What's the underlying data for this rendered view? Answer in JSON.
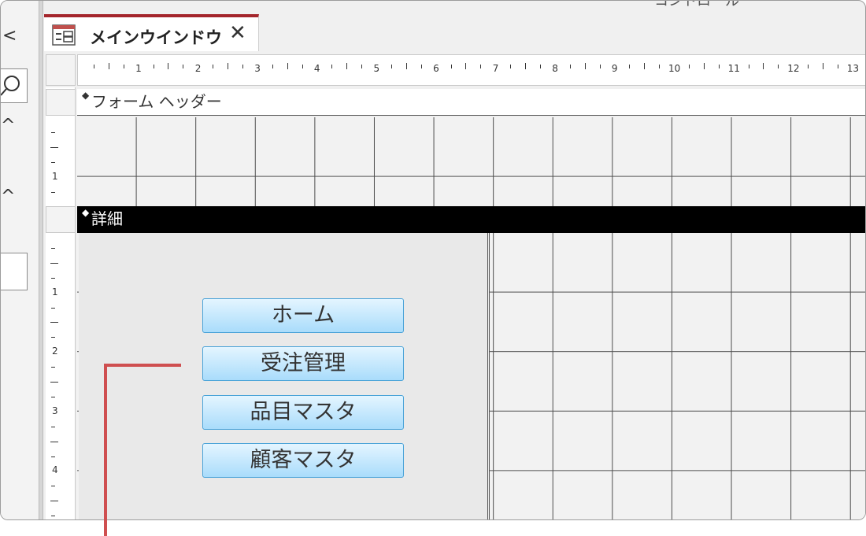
{
  "window": {
    "top_strip_text": "コントロール",
    "tab_title": "メインウインドウ",
    "close_glyph": "✕"
  },
  "left_pane": {
    "glyphs": [
      "<",
      "^",
      "^"
    ]
  },
  "ruler": {
    "h_numbers": [
      "1",
      "2",
      "3",
      "4",
      "5",
      "6",
      "7",
      "8",
      "9",
      "10",
      "11",
      "12",
      "13"
    ],
    "v_header_numbers": [
      "1"
    ],
    "v_detail_numbers": [
      "1",
      "2",
      "3",
      "4"
    ]
  },
  "sections": {
    "header_label": "フォーム ヘッダー",
    "detail_label": "詳細",
    "marker": "◆"
  },
  "buttons": [
    {
      "label": "ホーム"
    },
    {
      "label": "受注管理"
    },
    {
      "label": "品目マスタ"
    },
    {
      "label": "顧客マスタ"
    }
  ],
  "colors": {
    "tab_accent": "#a4262c",
    "callout": "#cf4f50",
    "button_border": "#4aa3d8"
  }
}
